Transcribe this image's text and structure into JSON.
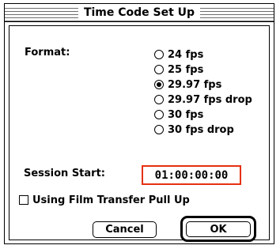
{
  "window": {
    "title": "Time Code Set Up"
  },
  "format": {
    "label": "Format:",
    "options": [
      {
        "label": "24 fps",
        "selected": false
      },
      {
        "label": "25 fps",
        "selected": false
      },
      {
        "label": "29.97 fps",
        "selected": true
      },
      {
        "label": "29.97 fps drop",
        "selected": false
      },
      {
        "label": "30 fps",
        "selected": false
      },
      {
        "label": "30 fps drop",
        "selected": false
      }
    ]
  },
  "session_start": {
    "label": "Session Start:",
    "value": "01:00:00:00"
  },
  "film_transfer": {
    "label": "Using Film Transfer Pull Up",
    "checked": false
  },
  "buttons": {
    "cancel": "Cancel",
    "ok": "OK"
  },
  "colors": {
    "field_highlight": "#e6300f"
  }
}
